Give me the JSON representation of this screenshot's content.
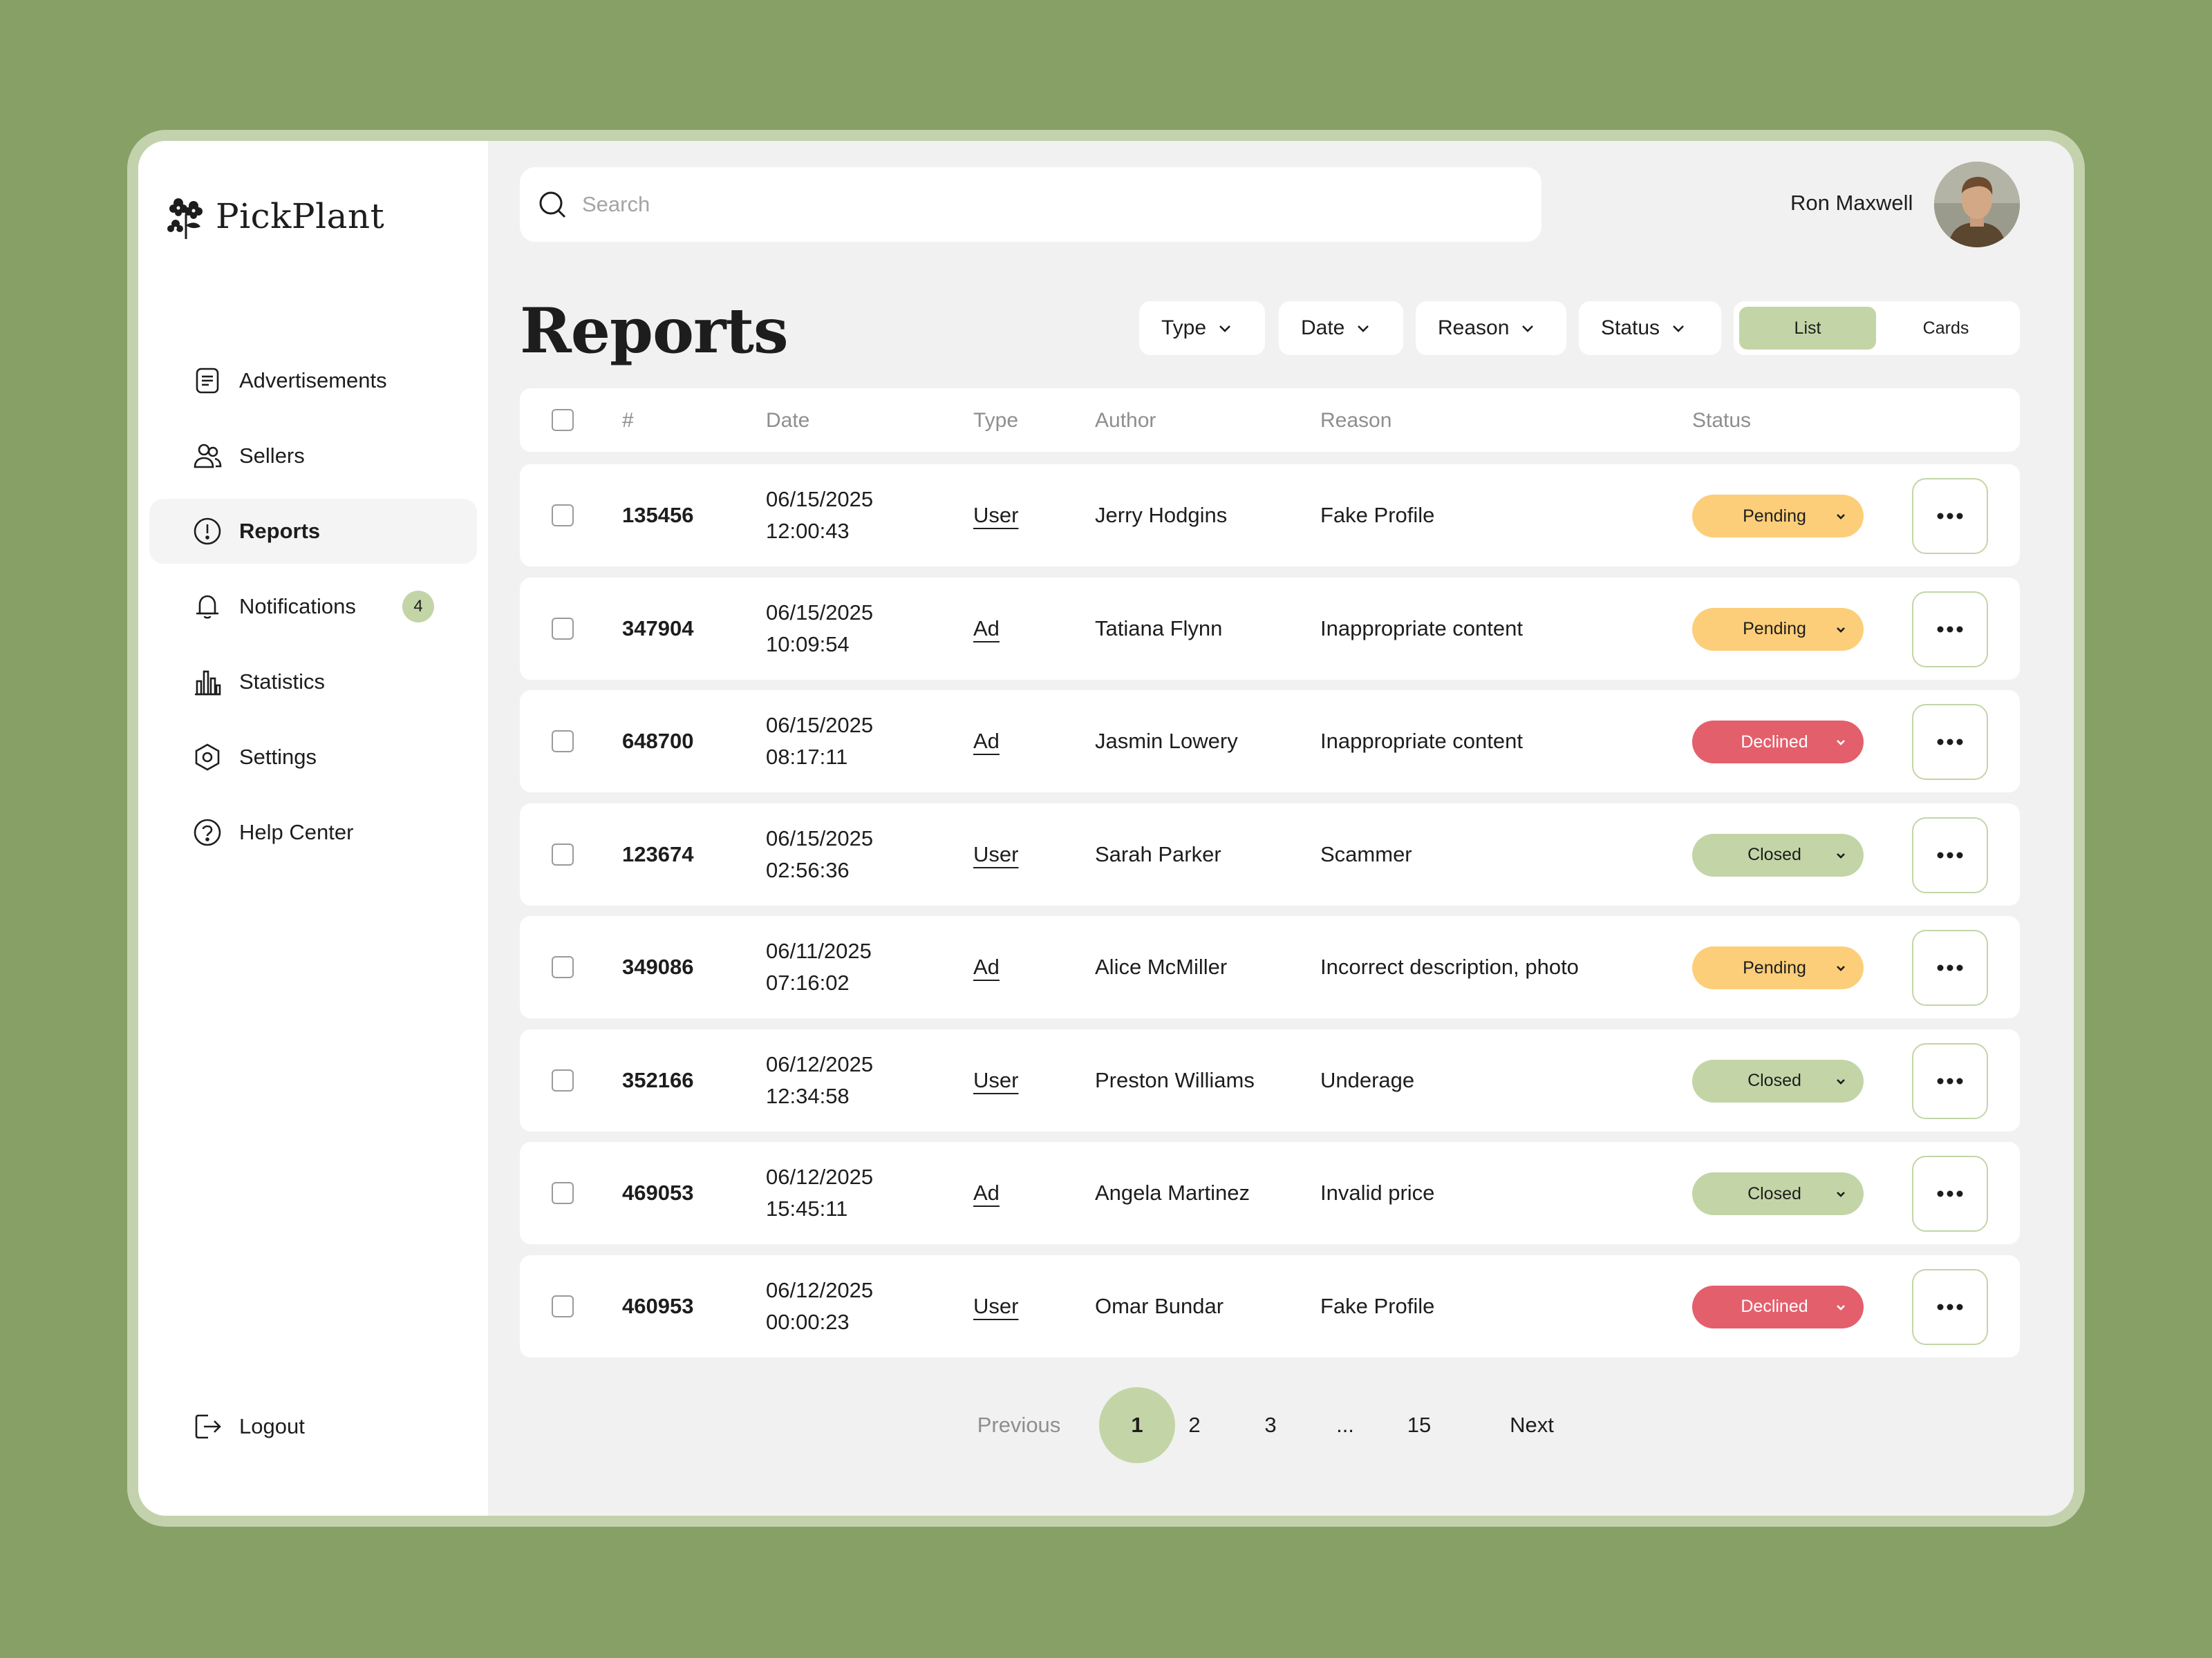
{
  "app": {
    "name": "PickPlant"
  },
  "sidebar": {
    "items": [
      {
        "label": "Advertisements",
        "icon": "document-list-icon"
      },
      {
        "label": "Sellers",
        "icon": "users-icon"
      },
      {
        "label": "Reports",
        "icon": "alert-circle-icon",
        "active": true
      },
      {
        "label": "Notifications",
        "icon": "bell-icon",
        "badge": "4"
      },
      {
        "label": "Statistics",
        "icon": "bar-chart-icon"
      },
      {
        "label": "Settings",
        "icon": "gear-icon"
      },
      {
        "label": "Help Center",
        "icon": "help-circle-icon"
      }
    ],
    "logout": "Logout"
  },
  "header": {
    "search_placeholder": "Search",
    "user_name": "Ron Maxwell"
  },
  "page": {
    "title": "Reports",
    "filters": [
      "Type",
      "Date",
      "Reason",
      "Status"
    ],
    "view_options": [
      "List",
      "Cards"
    ],
    "active_view": "List"
  },
  "table": {
    "columns": [
      "#",
      "Date",
      "Type",
      "Author",
      "Reason",
      "Status"
    ],
    "rows": [
      {
        "id": "135456",
        "date": "06/15/2025",
        "time": "12:00:43",
        "type": "User",
        "author": "Jerry Hodgins",
        "reason": "Fake Profile",
        "status": "Pending"
      },
      {
        "id": "347904",
        "date": "06/15/2025",
        "time": "10:09:54",
        "type": "Ad",
        "author": "Tatiana Flynn",
        "reason": "Inappropriate content",
        "status": "Pending"
      },
      {
        "id": "648700",
        "date": "06/15/2025",
        "time": "08:17:11",
        "type": "Ad",
        "author": "Jasmin Lowery",
        "reason": "Inappropriate content",
        "status": "Declined"
      },
      {
        "id": "123674",
        "date": "06/15/2025",
        "time": "02:56:36",
        "type": "User",
        "author": "Sarah Parker",
        "reason": "Scammer",
        "status": "Closed"
      },
      {
        "id": "349086",
        "date": "06/11/2025",
        "time": "07:16:02",
        "type": "Ad",
        "author": "Alice McMiller",
        "reason": "Incorrect description, photo",
        "status": "Pending"
      },
      {
        "id": "352166",
        "date": "06/12/2025",
        "time": "12:34:58",
        "type": "User",
        "author": "Preston Williams",
        "reason": "Underage",
        "status": "Closed"
      },
      {
        "id": "469053",
        "date": "06/12/2025",
        "time": "15:45:11",
        "type": "Ad",
        "author": "Angela Martinez",
        "reason": "Invalid price",
        "status": "Closed"
      },
      {
        "id": "460953",
        "date": "06/12/2025",
        "time": "00:00:23",
        "type": "User",
        "author": "Omar Bundar",
        "reason": "Fake Profile",
        "status": "Declined"
      }
    ]
  },
  "status_colors": {
    "Pending": {
      "bg": "#fcce79",
      "fg": "#1d1d1d"
    },
    "Declined": {
      "bg": "#e35f6c",
      "fg": "#ffffff"
    },
    "Closed": {
      "bg": "#c3d5a7",
      "fg": "#1d1d1d"
    }
  },
  "pagination": {
    "previous": "Previous",
    "pages": [
      "1",
      "2",
      "3",
      "...",
      "15"
    ],
    "current": "1",
    "next": "Next"
  },
  "colors": {
    "background": "#87a066",
    "accent": "#c3d5a7"
  }
}
